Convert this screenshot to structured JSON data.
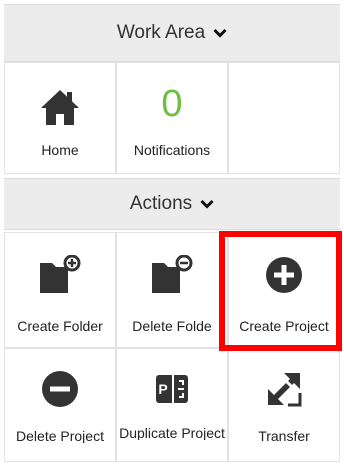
{
  "work_area": {
    "title": "Work Area",
    "tiles": [
      {
        "label": "Home",
        "icon": "home-icon"
      },
      {
        "label": "Notifications",
        "count": "0"
      }
    ]
  },
  "actions": {
    "title": "Actions",
    "tiles": [
      {
        "label": "Create Folder",
        "icon": "folder-plus-icon"
      },
      {
        "label": "Delete Folde",
        "icon": "folder-minus-icon"
      },
      {
        "label": "Create Project",
        "icon": "plus-circle-icon",
        "highlighted": true
      },
      {
        "label": "Delete Project",
        "icon": "minus-circle-icon"
      },
      {
        "label": "Duplicate Project",
        "icon": "duplicate-project-icon"
      },
      {
        "label": "Transfer",
        "icon": "transfer-icon"
      }
    ]
  },
  "colors": {
    "highlight": "#ff0000",
    "notification_count": "#6fbe44",
    "icon": "#333333",
    "header_bg": "#ececec"
  }
}
